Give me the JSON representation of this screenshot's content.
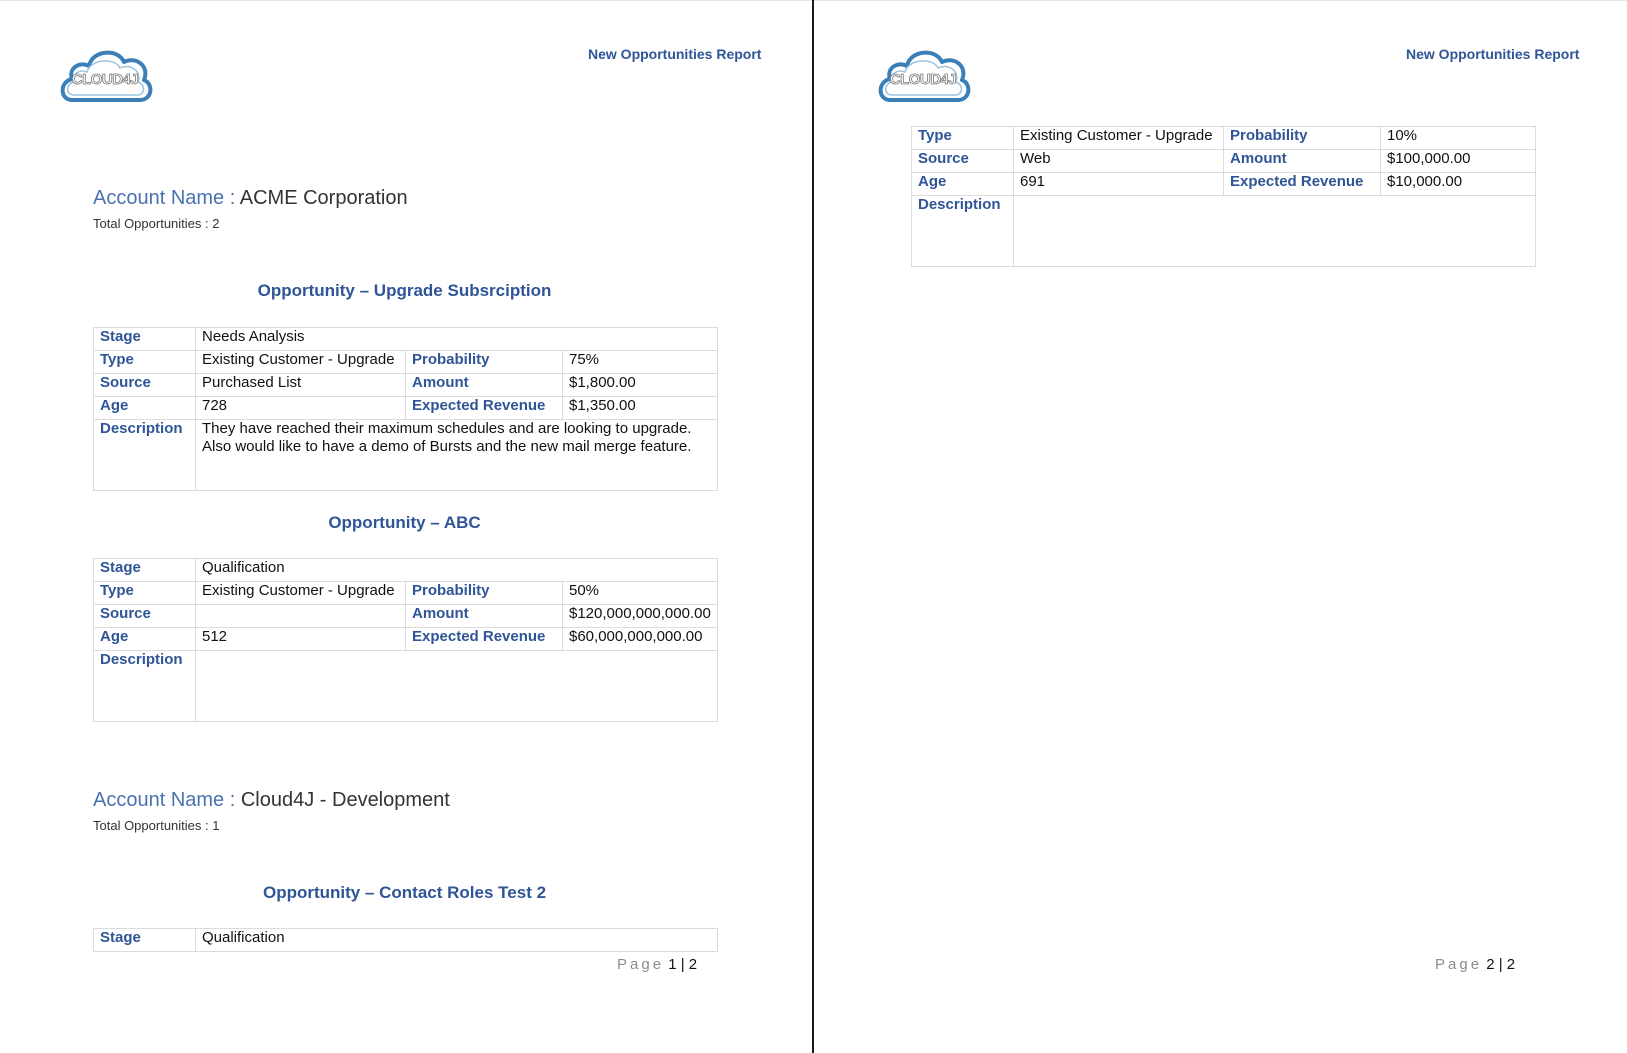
{
  "header": {
    "title": "New Opportunities Report",
    "logo_icon": "cloud4j-logo-icon",
    "logo_text": "CLOUD4J"
  },
  "labels": {
    "account_name": "Account Name : ",
    "total_opportunities": "Total Opportunities : ",
    "opportunity_prefix": "Opportunity – ",
    "stage": "Stage",
    "type": "Type",
    "source": "Source",
    "age": "Age",
    "description": "Description",
    "probability": "Probability",
    "amount": "Amount",
    "expected_revenue": "Expected Revenue",
    "page_word": "Page"
  },
  "accounts": [
    {
      "name": "ACME Corporation",
      "total": "2",
      "opportunities": [
        {
          "title": "Upgrade Subsrciption",
          "stage": "Needs Analysis",
          "type": "Existing Customer - Upgrade",
          "probability": "75%",
          "source": "Purchased List",
          "amount": "$1,800.00",
          "age": "728",
          "expected_revenue": "$1,350.00",
          "description": "They have reached their maximum schedules and are looking to upgrade. Also would like to have a demo of Bursts and the new mail merge feature."
        },
        {
          "title": "ABC",
          "stage": "Qualification",
          "type": "Existing Customer - Upgrade",
          "probability": "50%",
          "source": "",
          "amount": "$120,000,000,000.00",
          "age": "512",
          "expected_revenue": "$60,000,000,000.00",
          "description": ""
        }
      ]
    },
    {
      "name": "Cloud4J - Development",
      "total": "1",
      "opportunities": [
        {
          "title": "Contact Roles Test 2",
          "stage": "Qualification",
          "type": "Existing Customer - Upgrade",
          "probability": "10%",
          "source": "Web",
          "amount": "$100,000.00",
          "age": "691",
          "expected_revenue": "$10,000.00",
          "description": ""
        }
      ]
    }
  ],
  "pages": [
    {
      "current": "1",
      "sep": " | ",
      "total": "2"
    },
    {
      "current": "2",
      "sep": " | ",
      "total": "2"
    }
  ]
}
